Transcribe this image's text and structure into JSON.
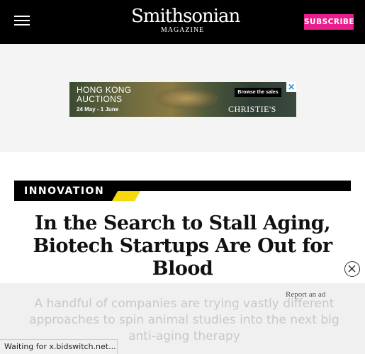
{
  "header": {
    "menu_icon": "hamburger-menu-icon",
    "logo_main": "Smithsonian",
    "logo_sub": "MAGAZINE",
    "subscribe_label": "SUBSCRIBE",
    "background": "#000000",
    "subscribe_color": "#e91e8c"
  },
  "ad": {
    "line1": "HONG KONG",
    "line2": "AUCTIONS",
    "dates": "24 May - 1 June",
    "browse_label": "Browse the sales",
    "brand": "CHRISTIE'S",
    "close_glyph": "✕"
  },
  "article": {
    "category": "INNOVATION",
    "category_accent": "#f5d90a",
    "headline": "In the Search to Stall Aging, Biotech Startups Are Out for Blood",
    "subhead": "A handful of companies are trying vastly different approaches to spin animal studies into the next big anti-aging therapy"
  },
  "overlay": {
    "report_ad": "Report an ad",
    "close_icon": "circle-close-icon"
  },
  "status_bar": {
    "text": "Waiting for x.bidswitch.net..."
  }
}
